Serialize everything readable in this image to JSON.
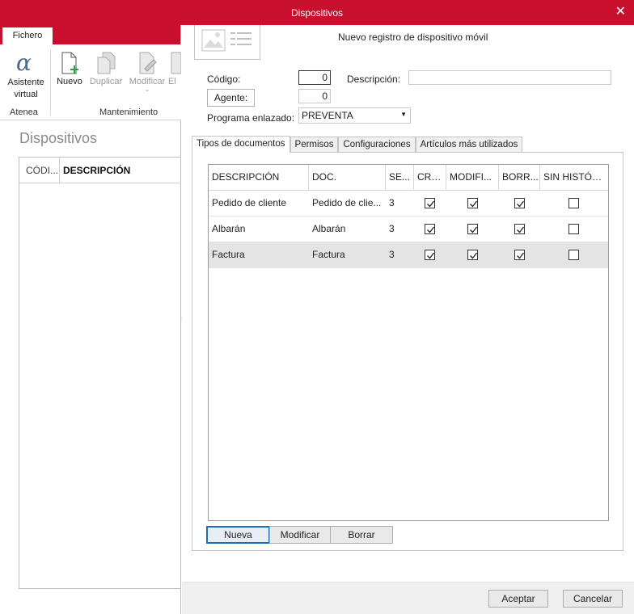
{
  "window": {
    "title": "Dispositivos",
    "close_glyph": "✕"
  },
  "ribbon": {
    "tab_label": "Fichero",
    "buttons": {
      "asistente": "Asistente virtual",
      "nuevo": "Nuevo",
      "duplicar": "Duplicar",
      "modificar": "Modificar",
      "eliminar": "El"
    },
    "groups": {
      "atenea": "Atenea",
      "mantenimiento": "Mantenimiento"
    }
  },
  "left_panel": {
    "title": "Dispositivos",
    "columns": {
      "codigo": "CÓDI...",
      "descripcion": "DESCRIPCIÓN"
    }
  },
  "splitter_glyph": "›",
  "form": {
    "title": "Nuevo registro de dispositivo móvil",
    "codigo_label": "Código:",
    "codigo_value": "0",
    "descripcion_label": "Descripción:",
    "descripcion_value": "",
    "agente_button": "Agente:",
    "agente_value": "0",
    "programa_label": "Programa enlazado:",
    "programa_value": "PREVENTA"
  },
  "tabs": [
    {
      "label": "Tipos de documentos",
      "active": true
    },
    {
      "label": "Permisos",
      "active": false
    },
    {
      "label": "Configuraciones",
      "active": false
    },
    {
      "label": "Artículos más utilizados",
      "active": false
    }
  ],
  "grid": {
    "columns": [
      "DESCRIPCIÓN",
      "DOC.",
      "SE...",
      "CRE...",
      "MODIFI...",
      "BORR...",
      "SIN HISTÓRI..."
    ],
    "rows": [
      {
        "descripcion": "Pedido de cliente",
        "doc": "Pedido de clie...",
        "serie": "3",
        "crear": true,
        "modificar": true,
        "borrar": true,
        "sin_historico": false,
        "selected": false
      },
      {
        "descripcion": "Albarán",
        "doc": "Albarán",
        "serie": "3",
        "crear": true,
        "modificar": true,
        "borrar": true,
        "sin_historico": false,
        "selected": false
      },
      {
        "descripcion": "Factura",
        "doc": "Factura",
        "serie": "3",
        "crear": true,
        "modificar": true,
        "borrar": true,
        "sin_historico": false,
        "selected": true
      }
    ]
  },
  "grid_buttons": {
    "nueva": "Nueva",
    "modificar": "Modificar",
    "borrar": "Borrar"
  },
  "dialog_buttons": {
    "aceptar": "Aceptar",
    "cancelar": "Cancelar"
  },
  "colors": {
    "accent": "#c8102e",
    "focus": "#1c6fb8",
    "new_icon_plus": "#2e9e3e"
  }
}
